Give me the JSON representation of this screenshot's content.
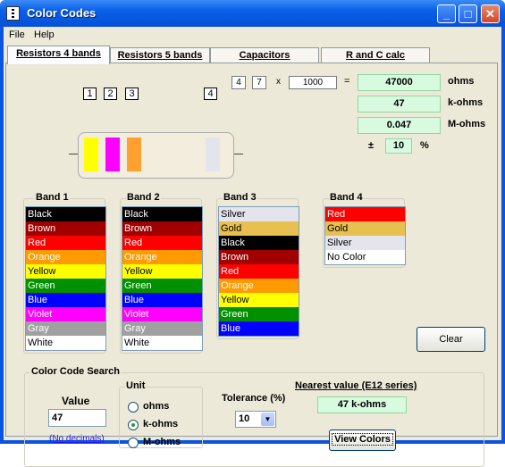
{
  "window": {
    "title": "Color Codes"
  },
  "menu": [
    "File",
    "Help"
  ],
  "tabs": [
    "Resistors 4 bands",
    "Resistors 5 bands",
    "Capacitors",
    "R and C calc"
  ],
  "calc": {
    "digit1": "4",
    "digit2": "7",
    "times": "x",
    "multiplier": "1000",
    "equals": "=",
    "ohms": "47000",
    "ohms_unit": "ohms",
    "kohms": "47",
    "kohms_unit": "k-ohms",
    "mohms": "0.047",
    "mohms_unit": "M-ohms",
    "pm": "±",
    "tolerance": "10",
    "percent": "%"
  },
  "resistor": {
    "labels": [
      "1",
      "2",
      "3",
      "4"
    ],
    "bands": [
      "#ffff00",
      "#ff00ff",
      "#ffa030",
      "#e4e4ec"
    ],
    "body_color": "#f3eddd"
  },
  "band_groups": [
    {
      "title": "Band 1",
      "items": [
        {
          "label": "Black",
          "bg": "#000000",
          "fg": "#ffffff"
        },
        {
          "label": "Brown",
          "bg": "#a00000",
          "fg": "#ffffff"
        },
        {
          "label": "Red",
          "bg": "#ff0000",
          "fg": "#ffffff"
        },
        {
          "label": "Orange",
          "bg": "#ff9a00",
          "fg": "#ffffff"
        },
        {
          "label": "Yellow",
          "bg": "#ffff00",
          "fg": "#000000"
        },
        {
          "label": "Green",
          "bg": "#009000",
          "fg": "#ffffff"
        },
        {
          "label": "Blue",
          "bg": "#0000ff",
          "fg": "#ffffff"
        },
        {
          "label": "Violet",
          "bg": "#ff00ff",
          "fg": "#ffffff"
        },
        {
          "label": "Gray",
          "bg": "#a0a0a0",
          "fg": "#ffffff"
        },
        {
          "label": "White",
          "bg": "#ffffff",
          "fg": "#000000"
        }
      ]
    },
    {
      "title": "Band 2",
      "items": [
        {
          "label": "Black",
          "bg": "#000000",
          "fg": "#ffffff"
        },
        {
          "label": "Brown",
          "bg": "#a00000",
          "fg": "#ffffff"
        },
        {
          "label": "Red",
          "bg": "#ff0000",
          "fg": "#ffffff"
        },
        {
          "label": "Orange",
          "bg": "#ff9a00",
          "fg": "#ffffff"
        },
        {
          "label": "Yellow",
          "bg": "#ffff00",
          "fg": "#000000"
        },
        {
          "label": "Green",
          "bg": "#009000",
          "fg": "#ffffff"
        },
        {
          "label": "Blue",
          "bg": "#0000ff",
          "fg": "#ffffff"
        },
        {
          "label": "Violet",
          "bg": "#ff00ff",
          "fg": "#ffffff"
        },
        {
          "label": "Gray",
          "bg": "#a0a0a0",
          "fg": "#ffffff"
        },
        {
          "label": "White",
          "bg": "#ffffff",
          "fg": "#000000"
        }
      ]
    },
    {
      "title": "Band 3",
      "items": [
        {
          "label": "Silver",
          "bg": "#e4e4ec",
          "fg": "#000000"
        },
        {
          "label": "Gold",
          "bg": "#e8c050",
          "fg": "#000000"
        },
        {
          "label": "Black",
          "bg": "#000000",
          "fg": "#ffffff"
        },
        {
          "label": "Brown",
          "bg": "#a00000",
          "fg": "#ffffff"
        },
        {
          "label": "Red",
          "bg": "#ff0000",
          "fg": "#ffffff"
        },
        {
          "label": "Orange",
          "bg": "#ff9a00",
          "fg": "#ffffff"
        },
        {
          "label": "Yellow",
          "bg": "#ffff00",
          "fg": "#000000"
        },
        {
          "label": "Green",
          "bg": "#009000",
          "fg": "#ffffff"
        },
        {
          "label": "Blue",
          "bg": "#0000ff",
          "fg": "#ffffff"
        }
      ]
    },
    {
      "title": "Band 4",
      "items": [
        {
          "label": "Red",
          "bg": "#ff0000",
          "fg": "#ffffff"
        },
        {
          "label": "Gold",
          "bg": "#e8c050",
          "fg": "#000000"
        },
        {
          "label": "Silver",
          "bg": "#e4e4ec",
          "fg": "#000000"
        },
        {
          "label": "No Color",
          "bg": "#ffffff",
          "fg": "#000000"
        }
      ]
    }
  ],
  "clear_label": "Clear",
  "search": {
    "title": "Color Code Search",
    "value_label": "Value",
    "value": "47",
    "no_decimals": "(No decimals)",
    "unit_title": "Unit",
    "units": [
      "ohms",
      "k-ohms",
      "M-ohms"
    ],
    "unit_selected": 1,
    "tolerance_label": "Tolerance (%)",
    "tolerance_value": "10",
    "nearest_label": "Nearest value (E12 series)",
    "nearest_value": "47 k-ohms",
    "view_colors": "View Colors"
  }
}
